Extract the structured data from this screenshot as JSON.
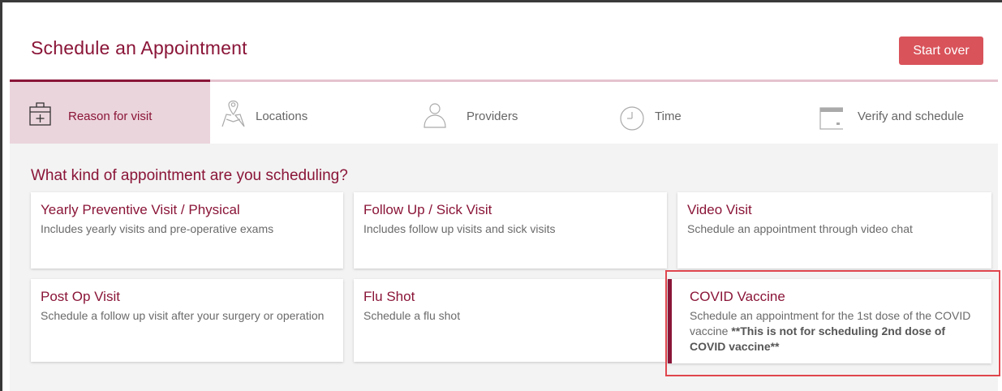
{
  "header": {
    "title": "Schedule an Appointment",
    "start_over_label": "Start over"
  },
  "steps": [
    {
      "label": "Reason for visit",
      "icon": "first-aid-kit-icon",
      "active": true
    },
    {
      "label": "Locations",
      "icon": "map-pin-icon",
      "active": false
    },
    {
      "label": "Providers",
      "icon": "person-icon",
      "active": false
    },
    {
      "label": "Time",
      "icon": "clock-icon",
      "active": false
    },
    {
      "label": "Verify and schedule",
      "icon": "calendar-icon",
      "active": false
    }
  ],
  "question": "What kind of appointment are you scheduling?",
  "cards": [
    {
      "title": "Yearly Preventive Visit / Physical",
      "description": "Includes yearly visits and pre-operative exams"
    },
    {
      "title": "Follow Up / Sick Visit",
      "description": "Includes follow up visits and sick visits"
    },
    {
      "title": "Video Visit",
      "description": "Schedule an appointment through video chat"
    },
    {
      "title": "Post Op Visit",
      "description": "Schedule a follow up visit after your surgery or operation"
    },
    {
      "title": "Flu Shot",
      "description": "Schedule a flu shot"
    },
    {
      "title": "COVID Vaccine",
      "description": "Schedule an appointment for the 1st dose of the COVID vaccine ",
      "description_bold": "**This is not for scheduling 2nd dose of COVID vaccine**",
      "selected": true
    }
  ],
  "colors": {
    "brand": "#8a1538",
    "button": "#d9535a",
    "active_step_bg": "#ebd5dc",
    "highlight": "#e0464e"
  }
}
